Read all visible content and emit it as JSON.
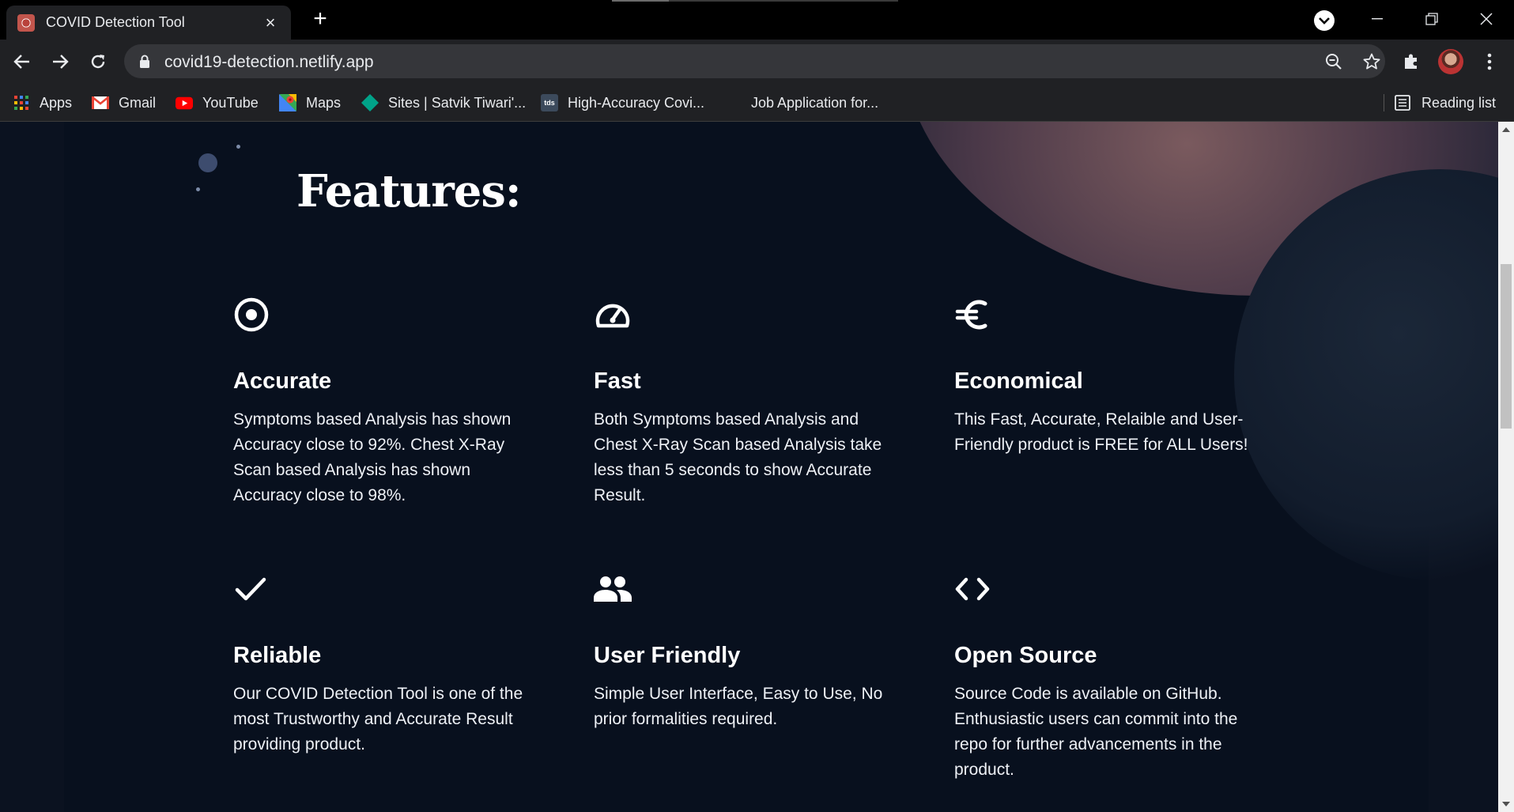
{
  "browser": {
    "tab_title": "COVID Detection Tool",
    "url": "covid19-detection.netlify.app",
    "bookmarks": [
      {
        "label": "Apps",
        "icon": "apps-grid-icon"
      },
      {
        "label": "Gmail",
        "icon": "gmail-icon"
      },
      {
        "label": "YouTube",
        "icon": "youtube-icon"
      },
      {
        "label": "Maps",
        "icon": "maps-icon"
      },
      {
        "label": "Sites | Satvik Tiwari'...",
        "icon": "sites-icon"
      },
      {
        "label": "High-Accuracy Covi...",
        "icon": "tds-icon",
        "icon_text": "tds"
      },
      {
        "label": "Job Application for...",
        "icon": ""
      }
    ],
    "reading_list": "Reading list"
  },
  "page": {
    "section_title": "Features:",
    "features": [
      {
        "title": "Accurate",
        "icon": "target-icon",
        "description": "Symptoms based Analysis has shown Accuracy close to 92%. Chest X-Ray Scan based Analysis has shown Accuracy close to 98%."
      },
      {
        "title": "Fast",
        "icon": "speedometer-icon",
        "description": "Both Symptoms based Analysis and Chest X-Ray Scan based Analysis take less than 5 seconds to show Accurate Result."
      },
      {
        "title": "Economical",
        "icon": "euro-icon",
        "description": "This Fast, Accurate, Relaible and User-Friendly product is FREE for ALL Users!"
      },
      {
        "title": "Reliable",
        "icon": "checkmark-icon",
        "description": "Our COVID Detection Tool is one of the most Trustworthy and Accurate Result providing product."
      },
      {
        "title": "User Friendly",
        "icon": "users-icon",
        "description": "Simple User Interface, Easy to Use, No prior formalities required."
      },
      {
        "title": "Open Source",
        "icon": "code-icon",
        "description": "Source Code is available on GitHub. Enthusiastic users can commit into the repo for further advancements in the product."
      }
    ]
  },
  "colors": {
    "page_background": "#08101e",
    "chrome_dark": "#202124",
    "text": "#ffffff"
  }
}
